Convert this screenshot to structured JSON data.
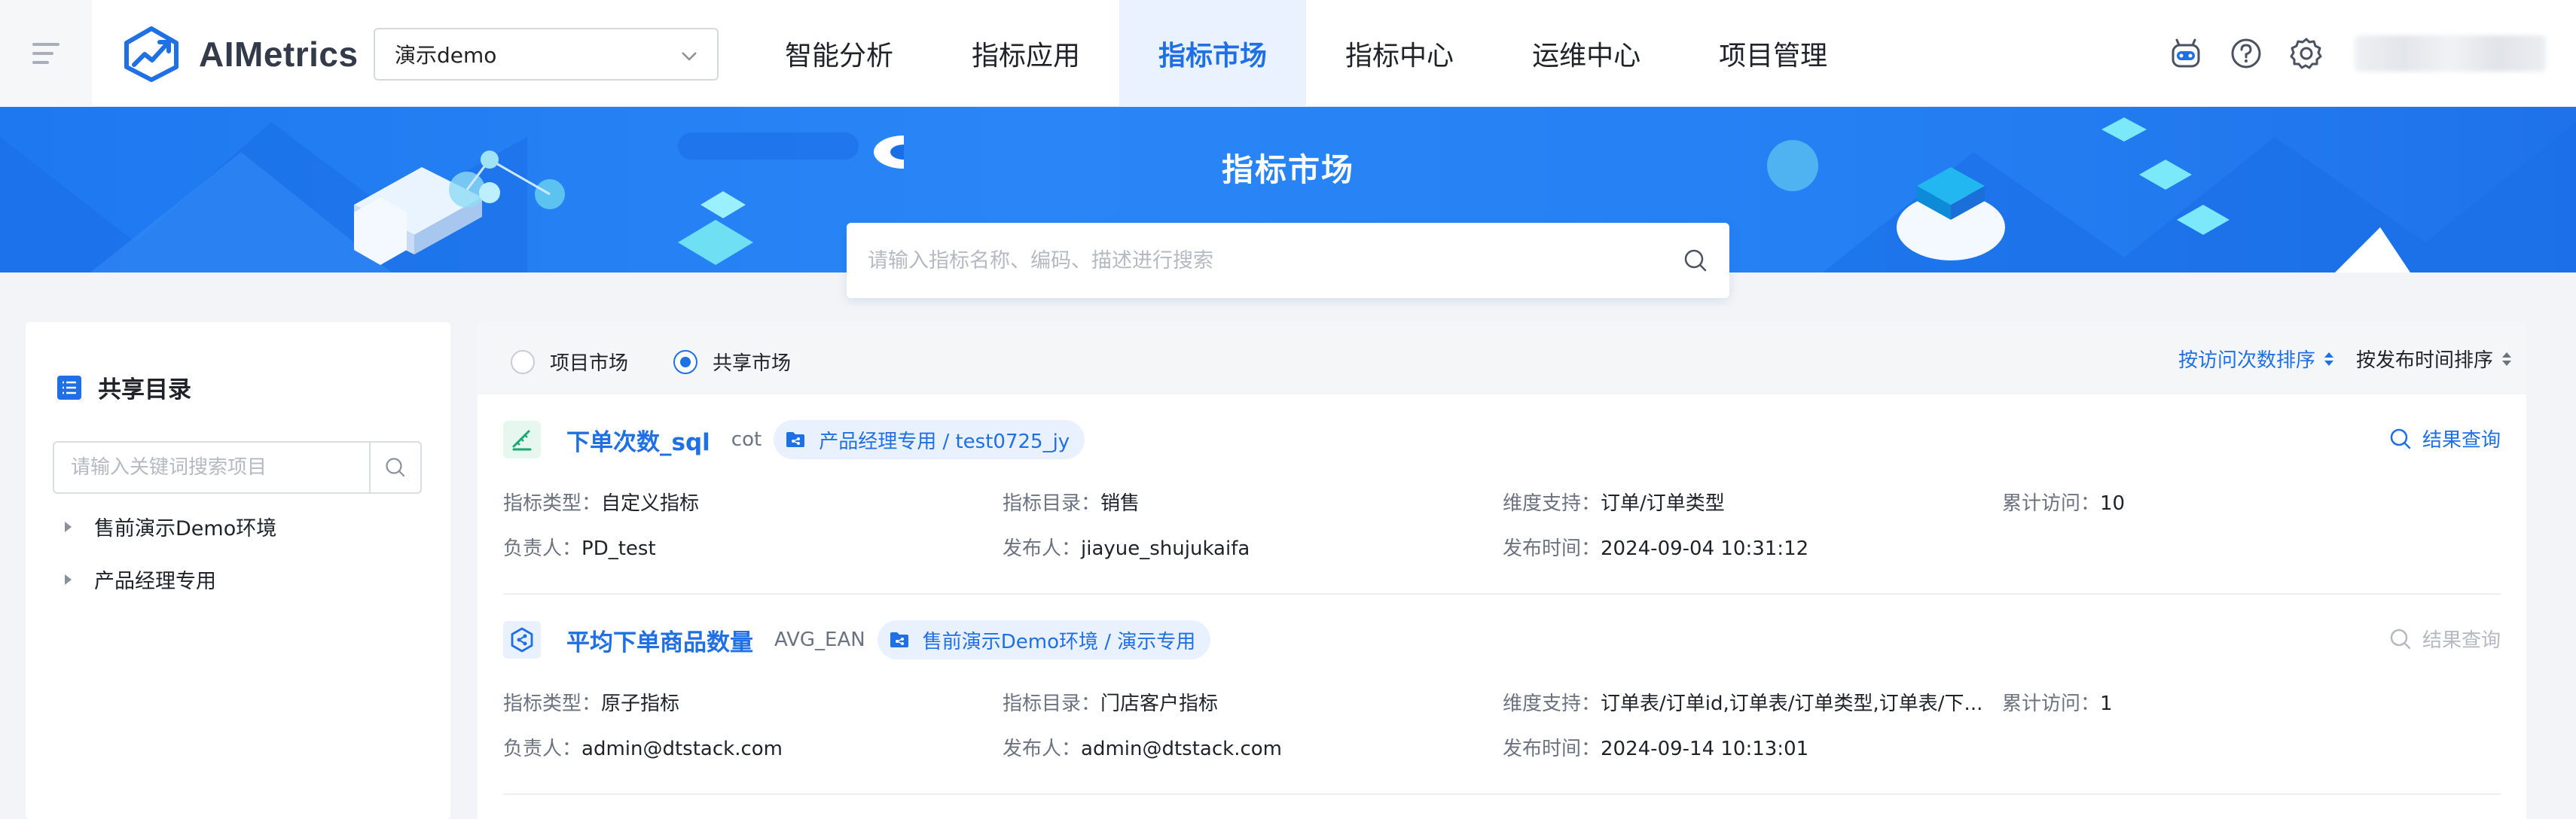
{
  "app": {
    "name": "AIMetrics"
  },
  "project_select": {
    "value": "演示demo"
  },
  "nav": [
    {
      "label": "智能分析",
      "active": false
    },
    {
      "label": "指标应用",
      "active": false
    },
    {
      "label": "指标市场",
      "active": true
    },
    {
      "label": "指标中心",
      "active": false
    },
    {
      "label": "运维中心",
      "active": false
    },
    {
      "label": "项目管理",
      "active": false
    }
  ],
  "banner": {
    "title": "指标市场",
    "search_placeholder": "请输入指标名称、编码、描述进行搜索"
  },
  "sidebar": {
    "title": "共享目录",
    "search_placeholder": "请输入关键词搜索项目",
    "items": [
      {
        "label": "售前演示Demo环境"
      },
      {
        "label": "产品经理专用"
      }
    ]
  },
  "filters": {
    "radios": [
      {
        "label": "项目市场",
        "checked": false
      },
      {
        "label": "共享市场",
        "checked": true
      }
    ],
    "sorts": [
      {
        "label": "按访问次数排序",
        "active": true
      },
      {
        "label": "按发布时间排序",
        "active": false
      }
    ]
  },
  "metrics": [
    {
      "name": "下单次数_sql",
      "code": "cot",
      "tag": "产品经理专用 / test0725_jy",
      "icon": "sql-metric-icon",
      "query_label": "结果查询",
      "query_enabled": true,
      "fields": [
        {
          "key": "指标类型：",
          "value": "自定义指标"
        },
        {
          "key": "指标目录：",
          "value": "销售"
        },
        {
          "key": "维度支持：",
          "value": "订单/订单类型"
        },
        {
          "key": "累计访问：",
          "value": "10"
        },
        {
          "key": "负责人：",
          "value": "PD_test"
        },
        {
          "key": "发布人：",
          "value": "jiayue_shujukaifa"
        },
        {
          "key": "发布时间：",
          "value": "2024-09-04 10:31:12"
        }
      ]
    },
    {
      "name": "平均下单商品数量",
      "code": "AVG_EAN",
      "tag": "售前演示Demo环境 / 演示专用",
      "icon": "atomic-metric-icon",
      "query_label": "结果查询",
      "query_enabled": false,
      "fields": [
        {
          "key": "指标类型：",
          "value": "原子指标"
        },
        {
          "key": "指标目录：",
          "value": "门店客户指标"
        },
        {
          "key": "维度支持：",
          "value": "订单表/订单id,订单表/订单类型,订单表/下..."
        },
        {
          "key": "累计访问：",
          "value": "1"
        },
        {
          "key": "负责人：",
          "value": "admin@dtstack.com"
        },
        {
          "key": "发布人：",
          "value": "admin@dtstack.com"
        },
        {
          "key": "发布时间：",
          "value": "2024-09-14 10:13:01"
        }
      ]
    }
  ],
  "colors": {
    "primary": "#1f6fe5",
    "banner": "#2581f3"
  }
}
